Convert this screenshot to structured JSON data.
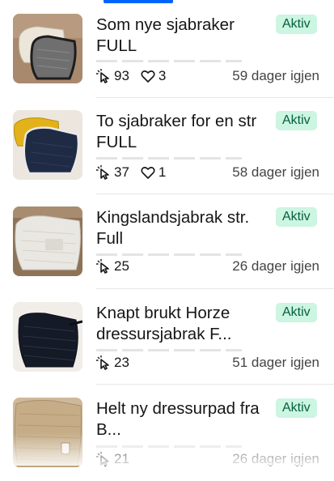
{
  "listings": [
    {
      "title": "Som nye sjabraker FULL",
      "status": "Aktiv",
      "clicks": "93",
      "favorites": "3",
      "days_left": "59 dager igjen"
    },
    {
      "title": "To sjabraker for en str FULL",
      "status": "Aktiv",
      "clicks": "37",
      "favorites": "1",
      "days_left": "58 dager igjen"
    },
    {
      "title": "Kingslandsjabrak str. Full",
      "status": "Aktiv",
      "clicks": "25",
      "favorites": null,
      "days_left": "26 dager igjen"
    },
    {
      "title": "Knapt brukt Horze dressursjabrak F...",
      "status": "Aktiv",
      "clicks": "23",
      "favorites": null,
      "days_left": "51 dager igjen"
    },
    {
      "title": "Helt ny dressurpad fra B...",
      "status": "Aktiv",
      "clicks": "21",
      "favorites": null,
      "days_left": "26 dager igjen"
    }
  ],
  "icons": {
    "clicks": "cursor-click-icon",
    "favorites": "heart-icon"
  },
  "colors": {
    "accent": "#0063fb",
    "badge_bg": "#ccf5e2",
    "badge_text": "#065f3d"
  }
}
